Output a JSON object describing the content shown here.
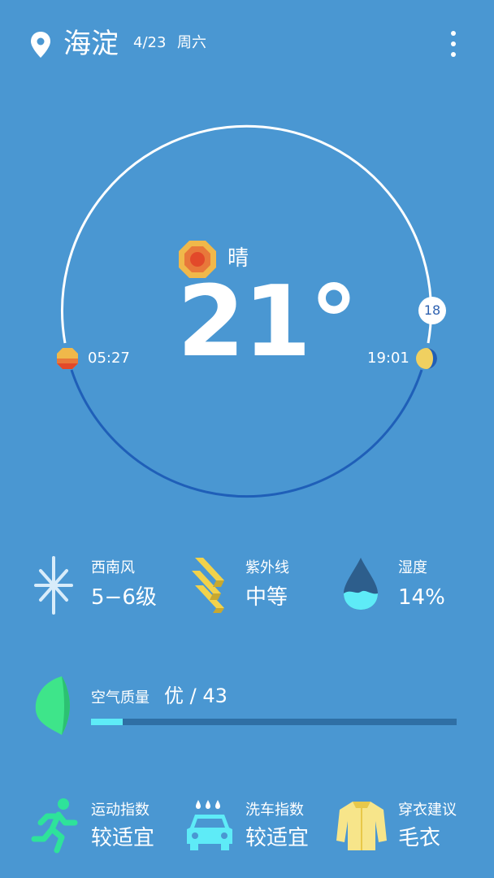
{
  "header": {
    "city": "海淀",
    "date": "4/23",
    "weekday": "周六"
  },
  "current": {
    "condition": "晴",
    "temperature": "21°",
    "sunrise": "05:27",
    "sunset": "19:01",
    "hour_badge": "18"
  },
  "metrics": [
    {
      "label": "西南风",
      "value": "5−6级",
      "icon": "wind-icon"
    },
    {
      "label": "紫外线",
      "value": "中等",
      "icon": "uv-icon"
    },
    {
      "label": "湿度",
      "value": "14%",
      "icon": "humidity-icon"
    }
  ],
  "air_quality": {
    "label": "空气质量",
    "value": "优 / 43",
    "aqi": 43,
    "bar_fraction": 0.086,
    "icon": "leaf-icon"
  },
  "life_index": [
    {
      "label": "运动指数",
      "value": "较适宜",
      "icon": "running-icon"
    },
    {
      "label": "洗车指数",
      "value": "较适宜",
      "icon": "car-wash-icon"
    },
    {
      "label": "穿衣建议",
      "value": "毛衣",
      "icon": "sweater-icon"
    }
  ],
  "colors": {
    "background": "#4A97D2",
    "arc_day": "#FFFFFF",
    "arc_night": "#1F5FB8",
    "aqi_fill": "#5EEBF7",
    "aqi_track": "#2F6FA5",
    "sun_outer": "#F0B84A",
    "sun_inner": "#E2492A",
    "leaf": "#3EE58A",
    "runner": "#2EE39A",
    "car": "#5EEBF7",
    "sweater": "#F7E58A"
  }
}
